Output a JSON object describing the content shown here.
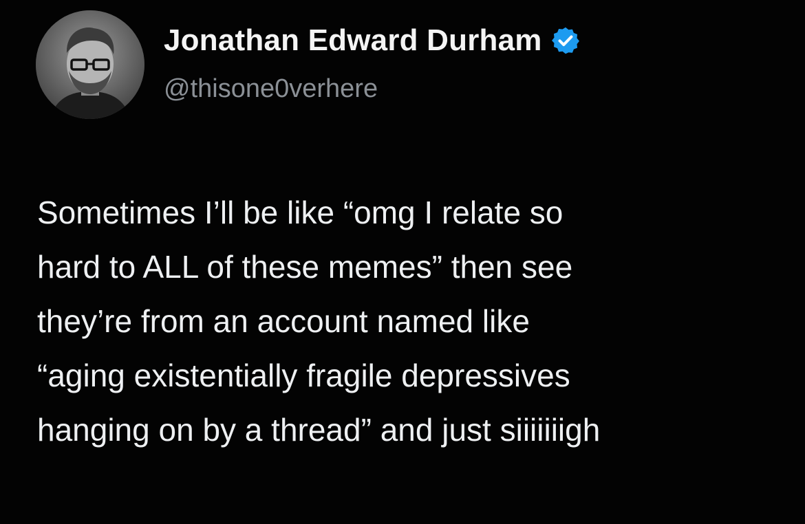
{
  "author": {
    "display_name": "Jonathan Edward Durham",
    "handle": "@thisone0verhere",
    "verified_color": "#1d9bf0",
    "avatar_icon": "profile-photo"
  },
  "tweet": {
    "lines": [
      "Sometimes I’ll be like “omg I relate so",
      "hard to ALL of these memes” then see",
      "they’re from an account named like",
      "“aging existentially fragile depressives",
      "hanging on by a thread” and just siiiiiiigh"
    ]
  }
}
